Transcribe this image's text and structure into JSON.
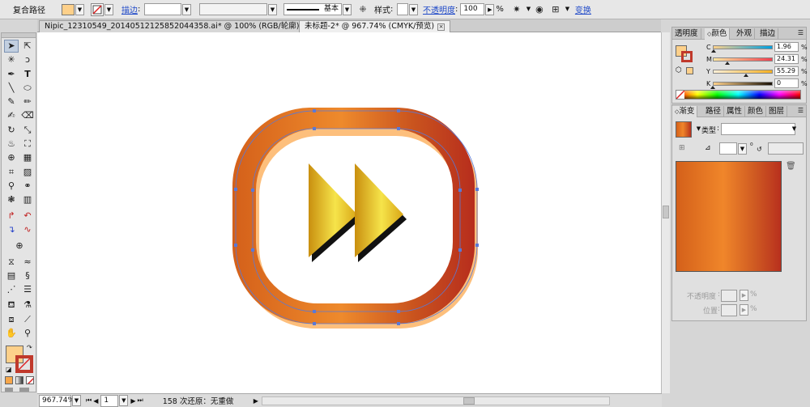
{
  "control_bar": {
    "object_type": "复合路径",
    "fill_color": "#fdd08a",
    "stroke_label": "描边",
    "stroke_weight": "",
    "stroke_profile": "",
    "brush_label": "基本",
    "style_label": "样式",
    "opacity_label": "不透明度",
    "opacity_value": "100",
    "opacity_unit": "%",
    "transform_label": "变换"
  },
  "document_tabs": [
    {
      "label": "Nipic_12310549_20140512125852044358.ai* @ 100% (RGB/轮廓)",
      "active": false
    },
    {
      "label": "未标题-2* @ 967.74% (CMYK/预览)",
      "active": true
    }
  ],
  "status_bar": {
    "zoom": "967.74%",
    "page": "1",
    "status_text": "158 次还原：无重做"
  },
  "tools_panel": {
    "fill_color": "#fdd08a",
    "stroke_color": "#c0392b"
  },
  "color_panel": {
    "tabs": [
      "透明度",
      "颜色",
      "外观",
      "描边"
    ],
    "active_tab": "颜色",
    "fill_swatch": "#fdd08a",
    "channels": [
      {
        "label": "C",
        "value": "1.96",
        "unit": "%",
        "level": 0.02
      },
      {
        "label": "M",
        "value": "24.31",
        "unit": "%",
        "level": 0.24
      },
      {
        "label": "Y",
        "value": "55.29",
        "unit": "%",
        "level": 0.55
      },
      {
        "label": "K",
        "value": "0",
        "unit": "%",
        "level": 0.0
      }
    ]
  },
  "gradient_panel": {
    "tabs": [
      "渐变",
      "路径",
      "属性",
      "颜色",
      "图层"
    ],
    "active_tab": "渐变",
    "type_label": "类型",
    "type_value": "",
    "angle_value": "",
    "location_value": "",
    "opacity_label": "不透明度",
    "location_label": "位置",
    "percent": "%",
    "gradient_colors": [
      "#d4601a",
      "#f0862a",
      "#cf5a22",
      "#b8301e"
    ]
  },
  "artwork": {
    "ring_gradient": [
      "#d4601a",
      "#ee8a2c",
      "#c9531e",
      "#b72d1d"
    ],
    "ring_shadow": "#fdbf7c",
    "arrow_gradient": [
      "#c98f0f",
      "#f6e44a",
      "#d9a516"
    ],
    "arrow_shadow": "#111111",
    "selection_color": "#5a79d6"
  }
}
